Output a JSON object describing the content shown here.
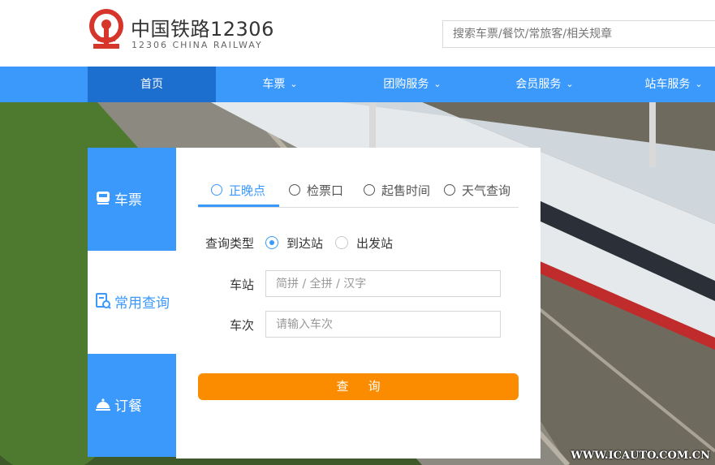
{
  "header": {
    "brand_cn": "中国铁路12306",
    "brand_en": "12306 CHINA RAILWAY",
    "search_placeholder": "搜索车票/餐饮/常旅客/相关规章"
  },
  "nav": {
    "items": [
      {
        "label": "首页",
        "active": true,
        "dropdown": false
      },
      {
        "label": "车票",
        "active": false,
        "dropdown": true
      },
      {
        "label": "团购服务",
        "active": false,
        "dropdown": true
      },
      {
        "label": "会员服务",
        "active": false,
        "dropdown": true
      },
      {
        "label": "站车服务",
        "active": false,
        "dropdown": true
      }
    ]
  },
  "side_tabs": [
    {
      "label": "车票",
      "icon": "train-icon",
      "active": false
    },
    {
      "label": "常用查询",
      "icon": "document-search-icon",
      "active": true
    },
    {
      "label": "订餐",
      "icon": "dining-bell-icon",
      "active": false
    }
  ],
  "panel": {
    "tabs": [
      {
        "label": "正晚点",
        "icon": "clock-icon",
        "active": true
      },
      {
        "label": "检票口",
        "icon": "gate-icon",
        "active": false
      },
      {
        "label": "起售时间",
        "icon": "sale-time-icon",
        "active": false
      },
      {
        "label": "天气查询",
        "icon": "weather-icon",
        "active": false
      }
    ],
    "query_type_label": "查询类型",
    "radio_arrival": "到达站",
    "radio_departure": "出发站",
    "station_label": "车站",
    "station_placeholder": "简拼 / 全拼 / 汉字",
    "train_label": "车次",
    "train_placeholder": "请输入车次",
    "query_button": "查询"
  },
  "watermark": "WWW.ICAUTO.COM.CN",
  "colors": {
    "primary_blue": "#3b99fc",
    "nav_active": "#1c6ecf",
    "logo_red": "#d6352b",
    "button_orange": "#fb8c00"
  }
}
